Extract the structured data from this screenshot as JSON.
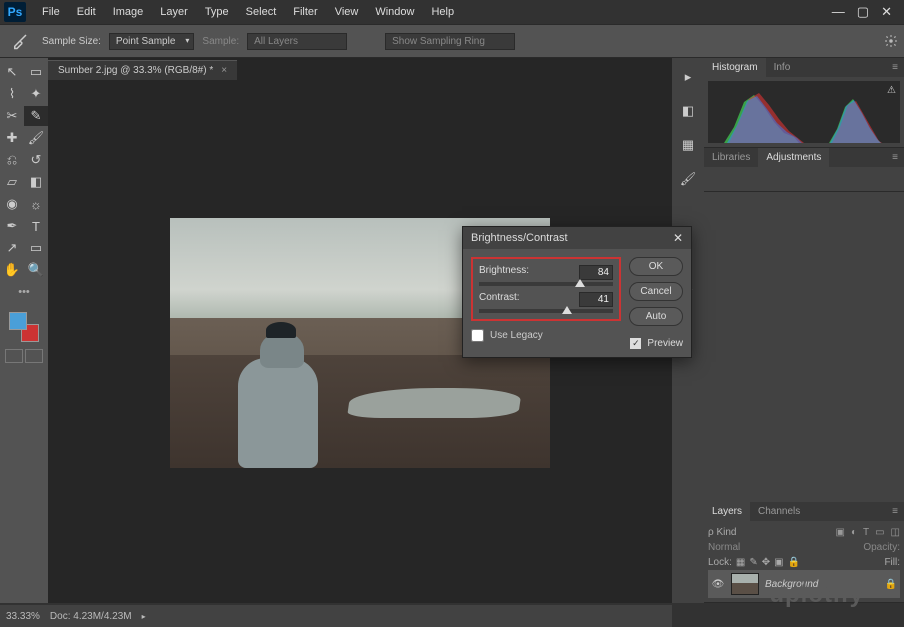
{
  "app": {
    "logo": "Ps"
  },
  "menu": [
    "File",
    "Edit",
    "Image",
    "Layer",
    "Type",
    "Select",
    "Filter",
    "View",
    "Window",
    "Help"
  ],
  "options_bar": {
    "sample_size_label": "Sample Size:",
    "sample_size_value": "Point Sample",
    "sample_label": "Sample:",
    "sample_value": "All Layers",
    "sampling_ring": "Show Sampling Ring"
  },
  "document": {
    "tab_title": "Sumber 2.jpg @ 33.3% (RGB/8#) *"
  },
  "dialog": {
    "title": "Brightness/Contrast",
    "brightness_label": "Brightness:",
    "brightness_value": "84",
    "brightness_pct": 72,
    "contrast_label": "Contrast:",
    "contrast_value": "41",
    "contrast_pct": 62,
    "use_legacy": "Use Legacy",
    "ok": "OK",
    "cancel": "Cancel",
    "auto": "Auto",
    "preview": "Preview"
  },
  "panels": {
    "histogram_tab": "Histogram",
    "info_tab": "Info",
    "libraries_tab": "Libraries",
    "adjustments_tab": "Adjustments",
    "layers_tab": "Layers",
    "channels_tab": "Channels",
    "blend_mode": "Normal",
    "opacity_label": "Opacity:",
    "fill_label": "Fill:",
    "lock_label": "Lock:",
    "layer_name": "Background"
  },
  "status": {
    "zoom": "33.33%",
    "doc_info": "Doc: 4.23M/4.23M"
  },
  "watermark": "uplotify"
}
